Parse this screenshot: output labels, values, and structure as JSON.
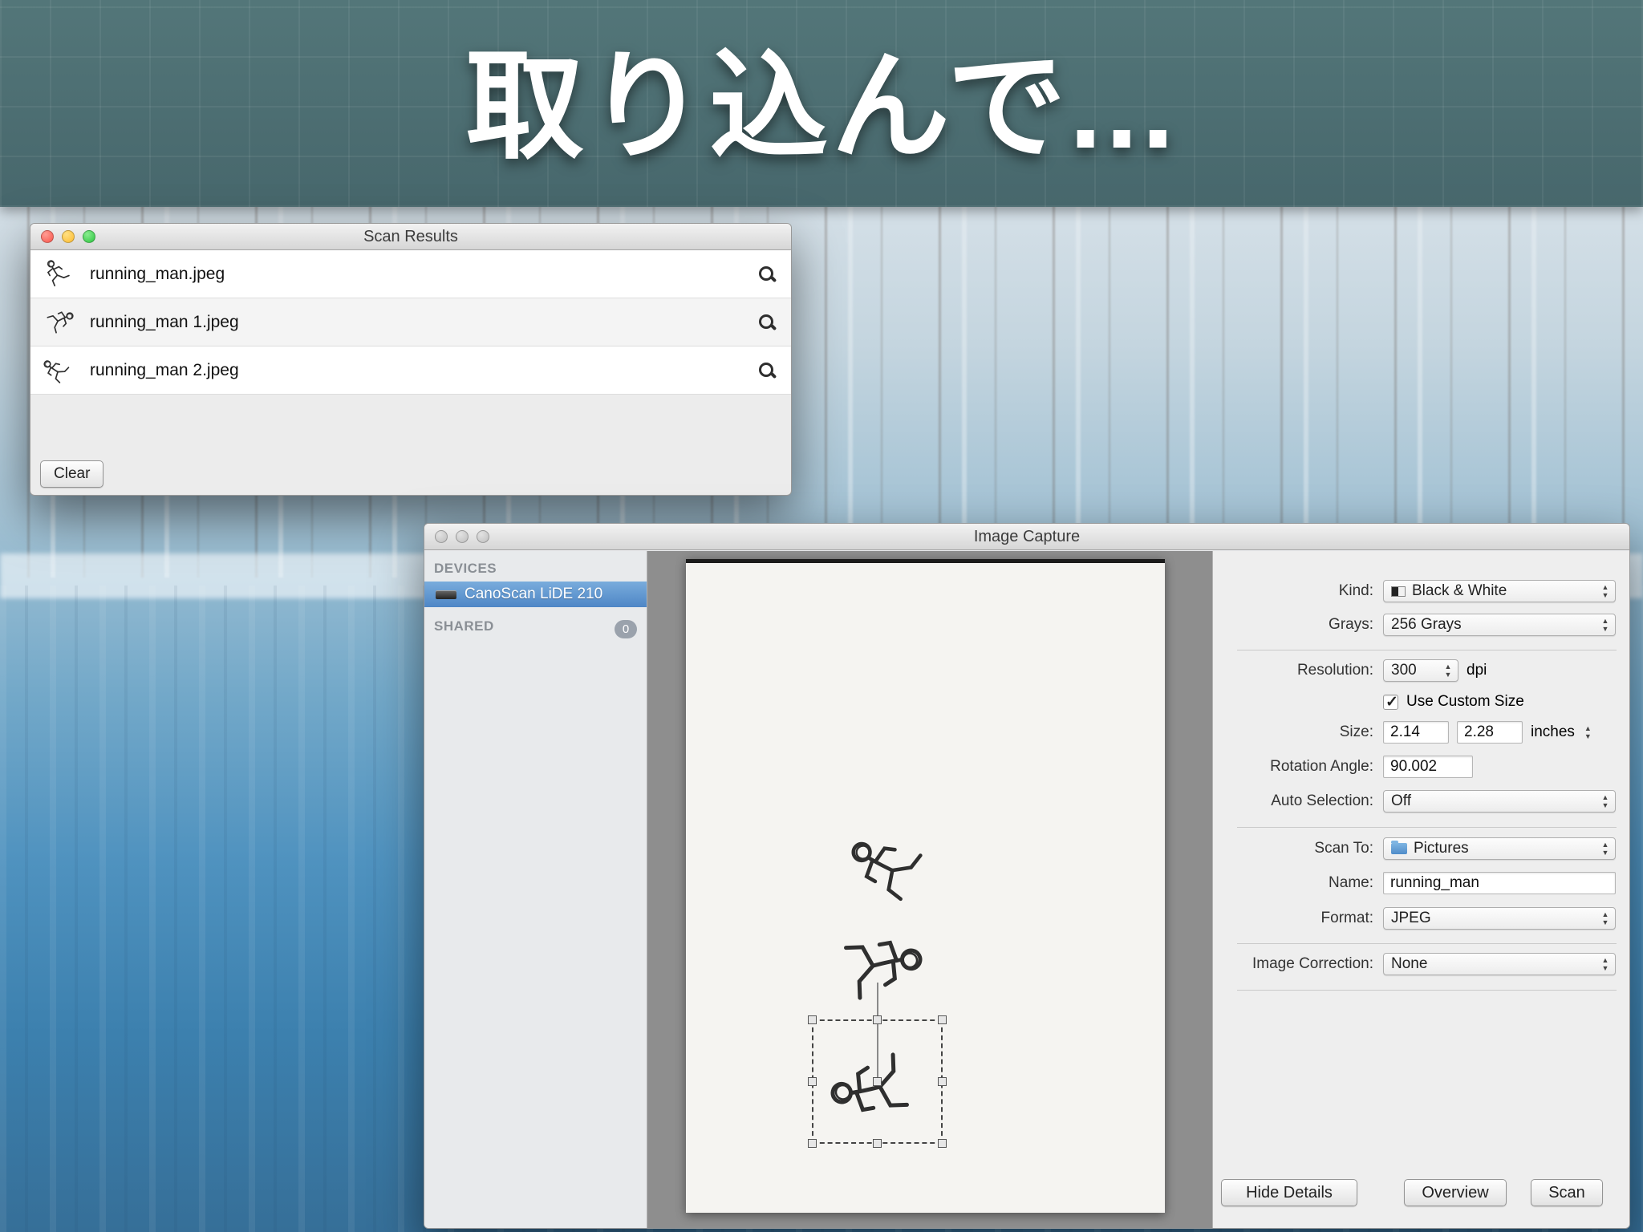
{
  "header": {
    "title": "取り込んで..."
  },
  "scan_results": {
    "window_title": "Scan Results",
    "files": [
      {
        "name": "running_man.jpeg"
      },
      {
        "name": "running_man 1.jpeg"
      },
      {
        "name": "running_man 2.jpeg"
      }
    ],
    "clear_button": "Clear"
  },
  "image_capture": {
    "window_title": "Image Capture",
    "sidebar": {
      "devices_header": "DEVICES",
      "device_name": "CanoScan LiDE 210",
      "shared_header": "SHARED",
      "shared_count": "0"
    },
    "settings": {
      "kind_label": "Kind:",
      "kind_value": "Black & White",
      "grays_label": "Grays:",
      "grays_value": "256 Grays",
      "resolution_label": "Resolution:",
      "resolution_value": "300",
      "resolution_unit": "dpi",
      "use_custom_size": "Use Custom Size",
      "size_label": "Size:",
      "size_width": "2.14",
      "size_height": "2.28",
      "size_unit": "inches",
      "rotation_label": "Rotation Angle:",
      "rotation_value": "90.002",
      "auto_selection_label": "Auto Selection:",
      "auto_selection_value": "Off",
      "scan_to_label": "Scan To:",
      "scan_to_value": "Pictures",
      "name_label": "Name:",
      "name_value": "running_man",
      "format_label": "Format:",
      "format_value": "JPEG",
      "image_correction_label": "Image Correction:",
      "image_correction_value": "None"
    },
    "buttons": {
      "hide_details": "Hide Details",
      "overview": "Overview",
      "scan": "Scan"
    }
  }
}
